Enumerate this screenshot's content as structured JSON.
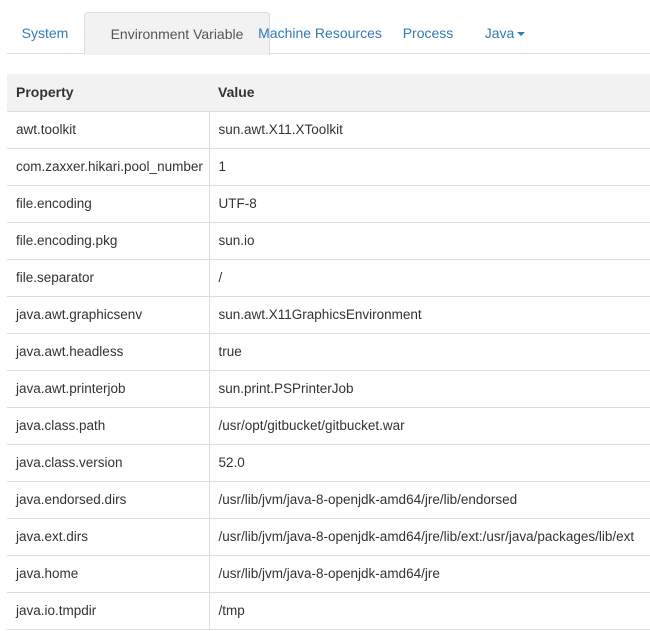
{
  "tabs": [
    {
      "label": "System",
      "active": false
    },
    {
      "label": "Environment Variable",
      "active": true
    },
    {
      "label": "Machine Resources",
      "active": false
    },
    {
      "label": "Process",
      "active": false
    },
    {
      "label": "Java",
      "active": false,
      "dropdown": true
    }
  ],
  "table": {
    "headers": {
      "property": "Property",
      "value": "Value"
    },
    "rows": [
      {
        "property": "awt.toolkit",
        "value": "sun.awt.X11.XToolkit"
      },
      {
        "property": "com.zaxxer.hikari.pool_number",
        "value": "1"
      },
      {
        "property": "file.encoding",
        "value": "UTF-8"
      },
      {
        "property": "file.encoding.pkg",
        "value": "sun.io"
      },
      {
        "property": "file.separator",
        "value": "/"
      },
      {
        "property": "java.awt.graphicsenv",
        "value": "sun.awt.X11GraphicsEnvironment"
      },
      {
        "property": "java.awt.headless",
        "value": "true"
      },
      {
        "property": "java.awt.printerjob",
        "value": "sun.print.PSPrinterJob"
      },
      {
        "property": "java.class.path",
        "value": "/usr/opt/gitbucket/gitbucket.war"
      },
      {
        "property": "java.class.version",
        "value": "52.0"
      },
      {
        "property": "java.endorsed.dirs",
        "value": "/usr/lib/jvm/java-8-openjdk-amd64/jre/lib/endorsed"
      },
      {
        "property": "java.ext.dirs",
        "value": "/usr/lib/jvm/java-8-openjdk-amd64/jre/lib/ext:/usr/java/packages/lib/ext"
      },
      {
        "property": "java.home",
        "value": "/usr/lib/jvm/java-8-openjdk-amd64/jre"
      },
      {
        "property": "java.io.tmpdir",
        "value": "/tmp"
      }
    ]
  },
  "colors": {
    "link": "#337ab7",
    "header_bg": "#f2f2f2",
    "border": "#dddddd",
    "text": "#333333"
  }
}
